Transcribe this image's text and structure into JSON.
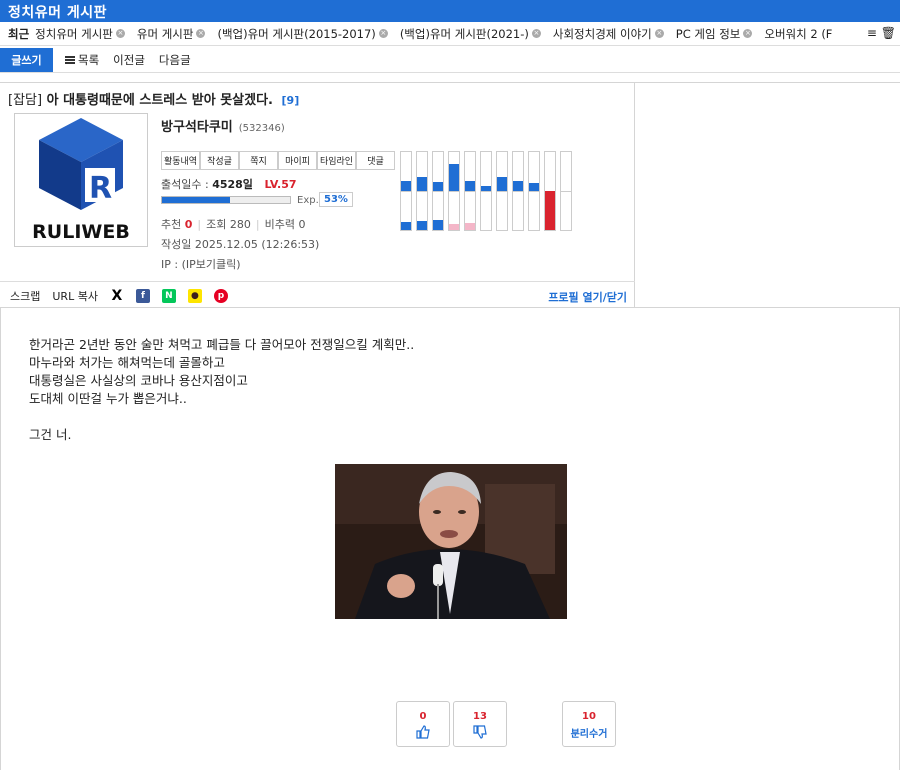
{
  "board_title": "정치유머 게시판",
  "recent": {
    "label": "최근",
    "items": [
      "정치유머 게시판",
      "유머 게시판",
      "(백업)유머 게시판(2015-2017)",
      "(백업)유머 게시판(2021-)",
      "사회정치경제 이야기",
      "PC 게임 정보",
      "오버워치 2 (F"
    ]
  },
  "toolbar": {
    "write": "글쓰기",
    "list": "목록",
    "prev": "이전글",
    "next": "다음글"
  },
  "post": {
    "category": "[잡담]",
    "title": "아 대통령때문에 스트레스 받아 못살겠다.",
    "comment_count": "[9]",
    "logo_text": "RULIWEB",
    "author": "방구석타쿠미",
    "author_id": "(532346)",
    "profile_buttons": [
      "활동내역",
      "작성글",
      "쪽지",
      "마이피",
      "타임라인",
      "댓글"
    ],
    "attendance_label": "출석일수 :",
    "attendance_value": "4528일",
    "level": "LV.57",
    "exp_label": "Exp.",
    "exp_percent": "53%",
    "exp_fraction": 0.53,
    "recommend_label": "추천",
    "recommend_value": "0",
    "views_label": "조회",
    "views_value": "280",
    "nonrecommend_label": "비추력",
    "nonrecommend_value": "0",
    "date_label": "작성일",
    "date_value": "2025.12.05 (12:26:53)",
    "ip_label": "IP :",
    "ip_value": "(IP보기클릭)"
  },
  "activity_graph": {
    "columns": [
      {
        "up": 0.25,
        "down": 0.2,
        "down_color": "#1f6ed4"
      },
      {
        "up": 0.35,
        "down": 0.22,
        "down_color": "#1f6ed4"
      },
      {
        "up": 0.22,
        "down": 0.25,
        "down_color": "#1f6ed4"
      },
      {
        "up": 0.7,
        "down": 0.15,
        "down_color": "#f4b6c8"
      },
      {
        "up": 0.25,
        "down": 0.17,
        "down_color": "#f4b6c8"
      },
      {
        "up": 0.12,
        "down": 0,
        "down_color": "#1f6ed4"
      },
      {
        "up": 0.35,
        "down": 0,
        "down_color": "#1f6ed4"
      },
      {
        "up": 0.25,
        "down": 0,
        "down_color": "#1f6ed4"
      },
      {
        "up": 0.2,
        "down": 0,
        "down_color": "#1f6ed4"
      },
      {
        "up": 0,
        "down": 1.0,
        "down_color": "#d9232e"
      },
      {
        "up": 0,
        "down": 0,
        "down_color": "#1f6ed4"
      }
    ]
  },
  "share": {
    "scrap": "스크랩",
    "url_copy": "URL 복사",
    "profile_toggle": "프로필 열기/닫기",
    "icons": [
      {
        "name": "x-icon",
        "glyph": "X",
        "color": "#000000"
      },
      {
        "name": "facebook-icon",
        "glyph": "f",
        "color": "#3b5998"
      },
      {
        "name": "naver-icon",
        "glyph": "N",
        "color": "#03c75a"
      },
      {
        "name": "kakao-icon",
        "glyph": "●",
        "color": "#fee500"
      },
      {
        "name": "pinterest-icon",
        "glyph": "p",
        "color": "#e60023"
      }
    ]
  },
  "content": {
    "lines": [
      "한거라곤 2년반 동안 술만 쳐먹고 폐급들 다 끌어모아 전쟁일으킬 계획만..",
      "마누라와 처가는 해쳐먹는데 골몰하고",
      "대통령실은 사실상의 코바나 용산지점이고",
      "도대체 이딴걸 누가 뽑은거냐..",
      "",
      "그건 너."
    ]
  },
  "votes": {
    "like_count": "0",
    "dislike_count": "13",
    "separate_count": "10",
    "separate_label": "분리수거"
  }
}
